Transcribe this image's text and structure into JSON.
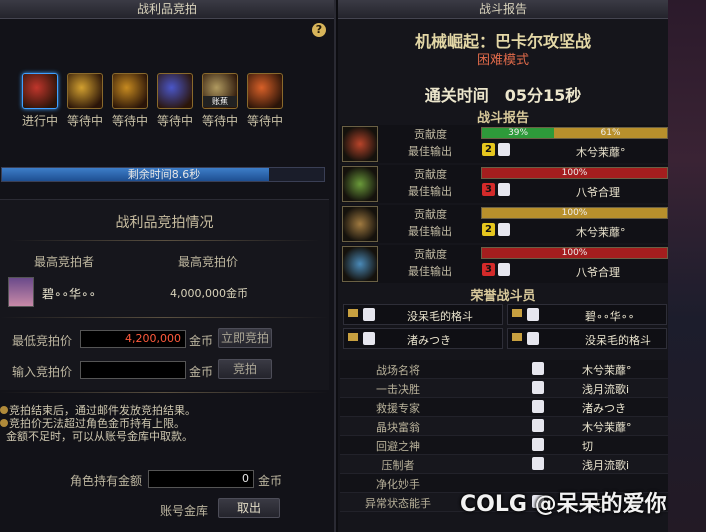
{
  "left": {
    "title": "战利品竞拍",
    "items": [
      {
        "status": "进行中",
        "color": "#c0362c"
      },
      {
        "status": "等待中",
        "color": "#d2a030"
      },
      {
        "status": "等待中",
        "color": "#c68a20"
      },
      {
        "status": "等待中",
        "color": "#4a56c8"
      },
      {
        "status": "等待中",
        "color": "#b09a60"
      },
      {
        "status": "等待中",
        "color": "#d86028"
      }
    ],
    "item5_tag": "账蕉",
    "time_remaining": "剩余时间8.6秒",
    "time_fraction": 0.83,
    "auction_title": "战利品竞拍情况",
    "col_bidder": "最高竞拍者",
    "col_price": "最高竞拍价",
    "bidder_name": "碧∘∘华∘∘",
    "bid_amount": "4,000,000金币",
    "min_bid_label": "最低竞拍价",
    "min_bid_value": "4,200,000",
    "gold": "金币",
    "btn_instant": "立即竞拍",
    "input_bid_label": "输入竞拍价",
    "btn_bid": "竞拍",
    "notices": [
      "竞拍结束后，通过邮件发放竞拍结果。",
      "竞拍价无法超过角色金币持有上限。",
      "金额不足时，可以从账号金库中取款。"
    ],
    "char_gold_label": "角色持有金额",
    "char_gold_value": "0",
    "vault_label": "账号金库",
    "btn_withdraw": "取出"
  },
  "right": {
    "title": "战斗报告",
    "dungeon_name": "机械崛起：巴卡尔攻坚战",
    "mode": "困难模式",
    "clear_time": "通关时间　05分15秒",
    "report_title": "战斗报告",
    "contrib_label": "贡献度",
    "best_label": "最佳输出",
    "parties": [
      {
        "segments": [
          {
            "text": "39%",
            "value": 0.39,
            "color": "#2e9a3a"
          },
          {
            "text": "61%",
            "value": 0.61,
            "color": "#b8902c"
          }
        ],
        "rank": "2",
        "rank_color": "#e6c61e",
        "name": "木兮茉蘼°",
        "portrait_color": "#b8442a"
      },
      {
        "segments": [
          {
            "text": "100%",
            "value": 1.0,
            "color": "#a41e1e"
          }
        ],
        "rank": "3",
        "rank_color": "#d42a2a",
        "name": "八爷合理",
        "portrait_color": "#6a9a3a"
      },
      {
        "segments": [
          {
            "text": "100%",
            "value": 1.0,
            "color": "#b8902c"
          }
        ],
        "rank": "2",
        "rank_color": "#e6c61e",
        "name": "木兮茉蘼°",
        "portrait_color": "#a07a40"
      },
      {
        "segments": [
          {
            "text": "100%",
            "value": 1.0,
            "color": "#a41e1e"
          }
        ],
        "rank": "3",
        "rank_color": "#d42a2a",
        "name": "八爷合理",
        "portrait_color": "#4a8ab8"
      }
    ],
    "honor_title": "荣誉战斗员",
    "honor": [
      {
        "name": "没呆毛的格斗"
      },
      {
        "name": "碧∘∘华∘∘"
      },
      {
        "name": "渚みつき"
      },
      {
        "name": "没呆毛的格斗"
      }
    ],
    "awards": [
      {
        "label": "战场名将",
        "name": "木兮茉蘼°"
      },
      {
        "label": "一击决胜",
        "name": "浅月流歌i"
      },
      {
        "label": "救援专家",
        "name": "渚みつき"
      },
      {
        "label": "晶块富翁",
        "name": "木兮茉蘼°"
      },
      {
        "label": "回避之神",
        "name": "切"
      },
      {
        "label": "压制者",
        "name": "浅月流歌i"
      },
      {
        "label": "净化妙手",
        "name": ""
      },
      {
        "label": "异常状态能手",
        "name": "鬼刀"
      }
    ]
  },
  "watermark": "COLG @呆呆的爱你"
}
